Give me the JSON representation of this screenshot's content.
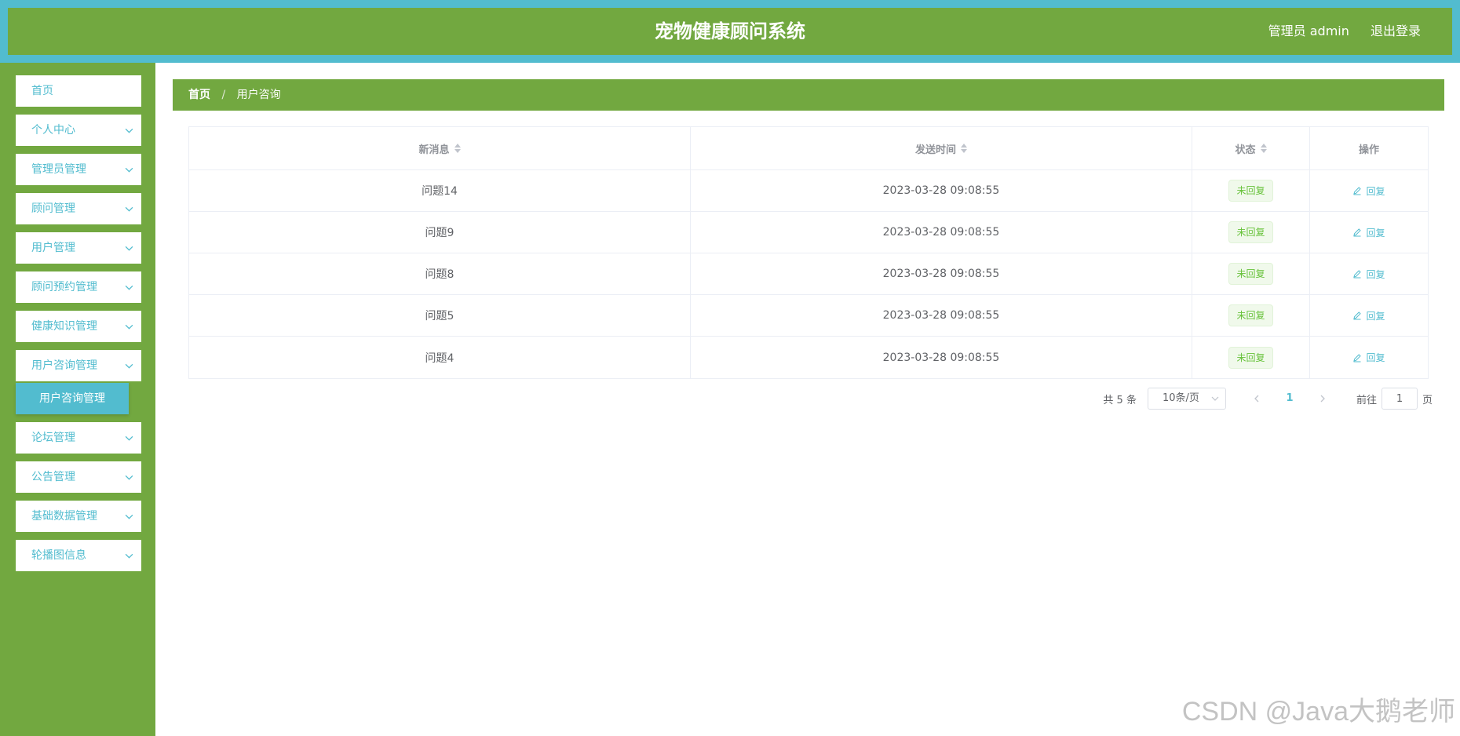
{
  "header": {
    "title": "宠物健康顾问系统",
    "user_label": "管理员 admin",
    "logout_label": "退出登录"
  },
  "sidebar": {
    "items": [
      {
        "label": "首页",
        "has_arrow": false
      },
      {
        "label": "个人中心",
        "has_arrow": true
      },
      {
        "label": "管理员管理",
        "has_arrow": true
      },
      {
        "label": "顾问管理",
        "has_arrow": true
      },
      {
        "label": "用户管理",
        "has_arrow": true
      },
      {
        "label": "顾问预约管理",
        "has_arrow": true
      },
      {
        "label": "健康知识管理",
        "has_arrow": true
      },
      {
        "label": "用户咨询管理",
        "has_arrow": true
      },
      {
        "label": "论坛管理",
        "has_arrow": true
      },
      {
        "label": "公告管理",
        "has_arrow": true
      },
      {
        "label": "基础数据管理",
        "has_arrow": true
      },
      {
        "label": "轮播图信息",
        "has_arrow": true
      }
    ],
    "active_submenu": "用户咨询管理"
  },
  "breadcrumb": {
    "home": "首页",
    "separator": "/",
    "current": "用户咨询"
  },
  "table": {
    "headers": [
      "新消息",
      "发送时间",
      "状态",
      "操作"
    ],
    "rows": [
      {
        "message": "问题14",
        "time": "2023-03-28 09:08:55",
        "status": "未回复",
        "action": "回复"
      },
      {
        "message": "问题9",
        "time": "2023-03-28 09:08:55",
        "status": "未回复",
        "action": "回复"
      },
      {
        "message": "问题8",
        "time": "2023-03-28 09:08:55",
        "status": "未回复",
        "action": "回复"
      },
      {
        "message": "问题5",
        "time": "2023-03-28 09:08:55",
        "status": "未回复",
        "action": "回复"
      },
      {
        "message": "问题4",
        "time": "2023-03-28 09:08:55",
        "status": "未回复",
        "action": "回复"
      }
    ]
  },
  "pagination": {
    "total_label": "共 5 条",
    "page_size": "10条/页",
    "current_page": "1",
    "goto_prefix": "前往",
    "goto_value": "1",
    "goto_suffix": "页"
  },
  "watermark": "CSDN @Java大鹅老师",
  "colors": {
    "primary_green": "#72a840",
    "accent_teal": "#52bccf",
    "status_green": "#67c23a"
  }
}
